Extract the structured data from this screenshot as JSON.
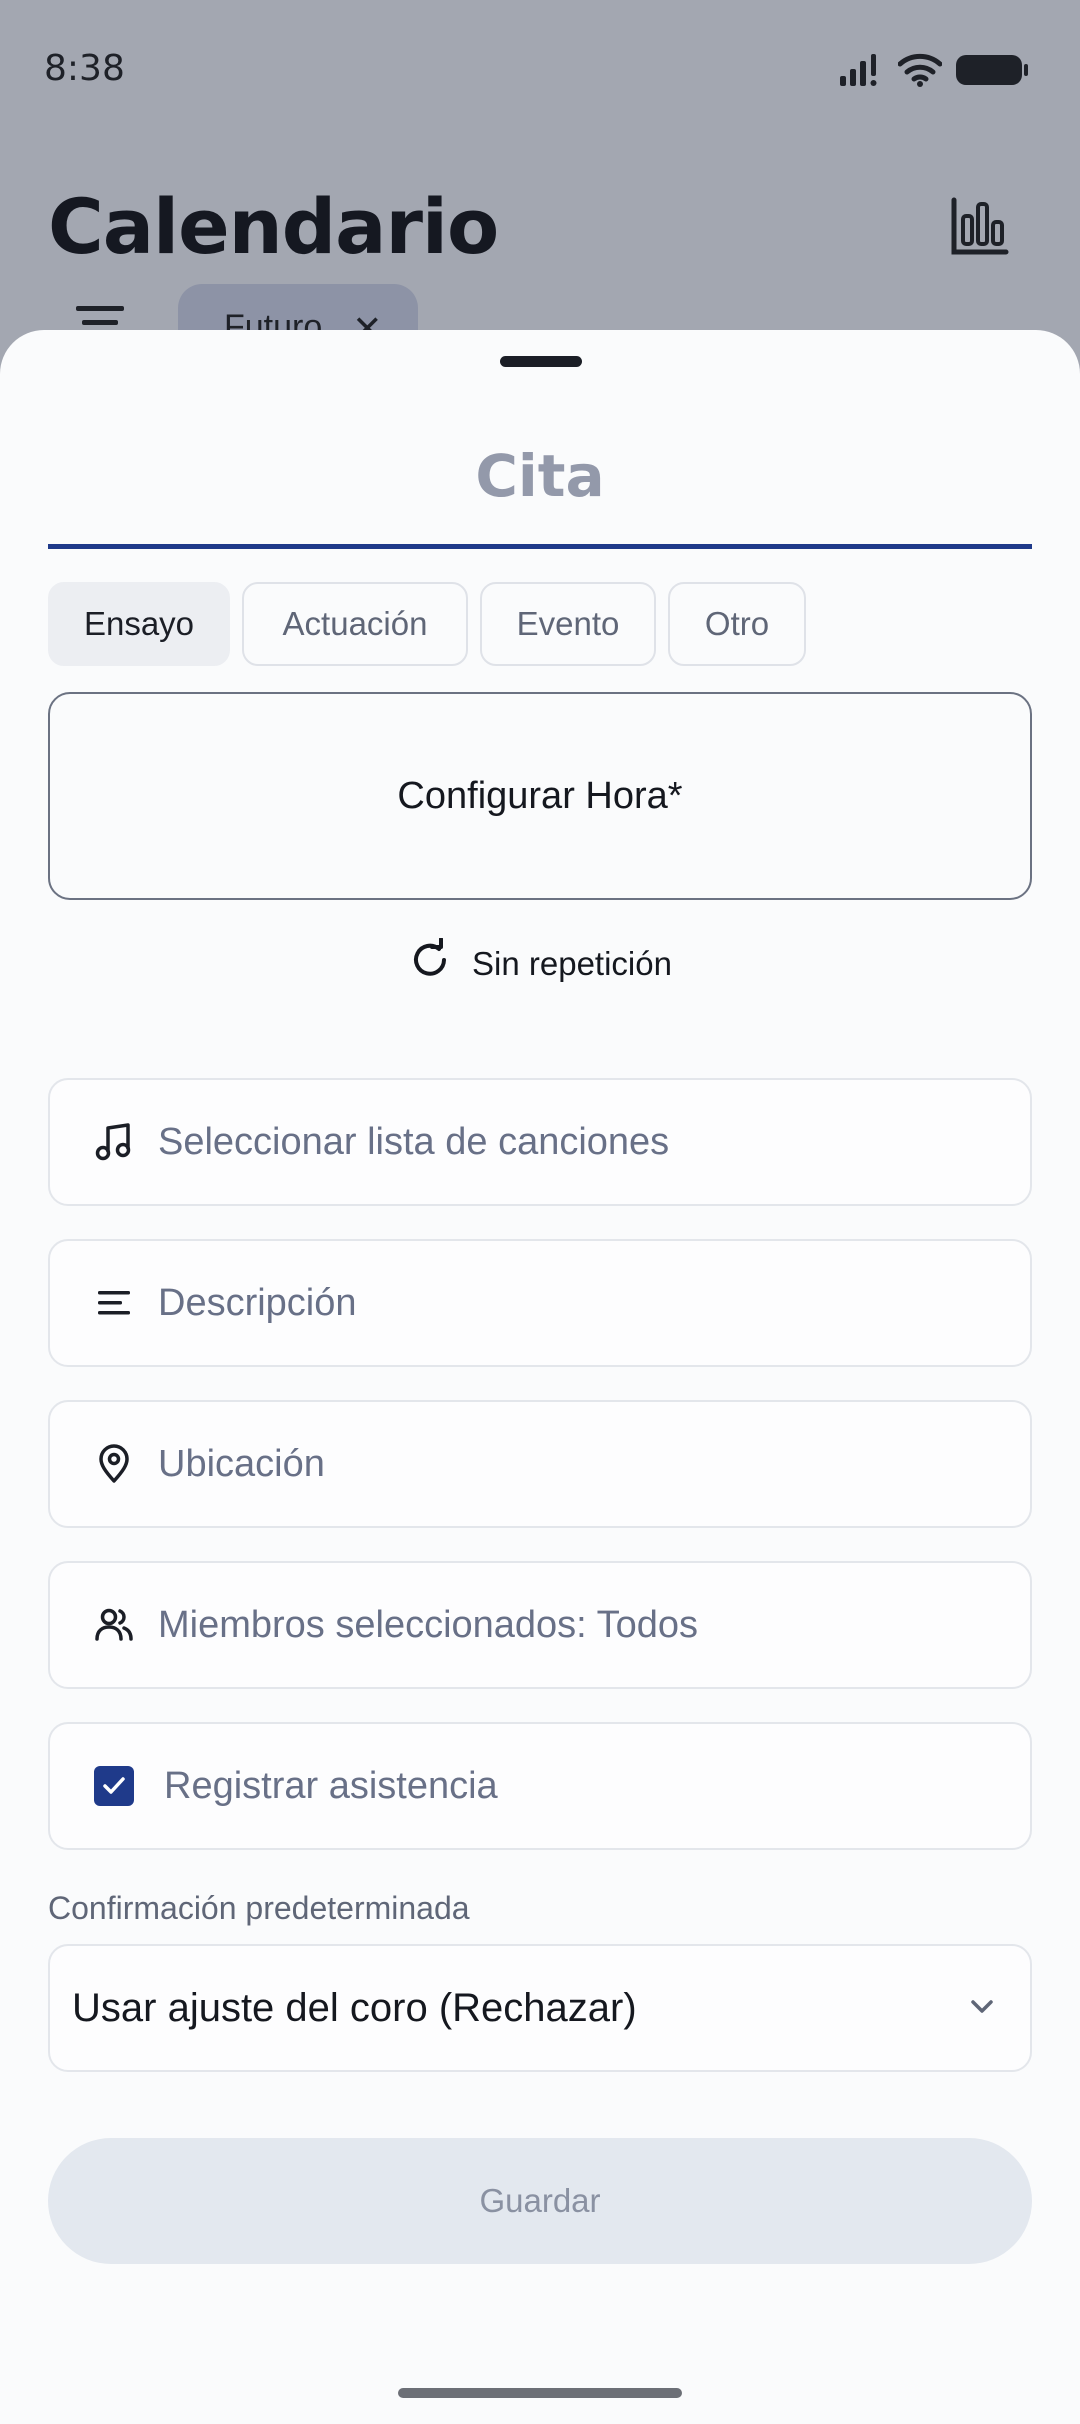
{
  "status_bar": {
    "time": "8:38"
  },
  "header": {
    "title": "Calendario",
    "filter_chip": "Futuro"
  },
  "sheet": {
    "title_placeholder": "Cita",
    "types": [
      {
        "label": "Ensayo",
        "selected": true
      },
      {
        "label": "Actuación",
        "selected": false
      },
      {
        "label": "Evento",
        "selected": false
      },
      {
        "label": "Otro",
        "selected": false
      }
    ],
    "set_time_label": "Configurar Hora*",
    "repeat_label": "Sin repetición",
    "fields": {
      "songlist": "Seleccionar lista de canciones",
      "description": "Descripción",
      "location": "Ubicación",
      "members": "Miembros seleccionados: Todos",
      "attendance": "Registrar asistencia"
    },
    "attendance_checked": true,
    "confirmation_label": "Confirmación predeterminada",
    "confirmation_value": "Usar ajuste del coro (Rechazar)",
    "save_label": "Guardar"
  },
  "colors": {
    "accent": "#1f3a8a",
    "scrim": "#a3a7b1",
    "sheet_bg": "#fafbfc"
  }
}
